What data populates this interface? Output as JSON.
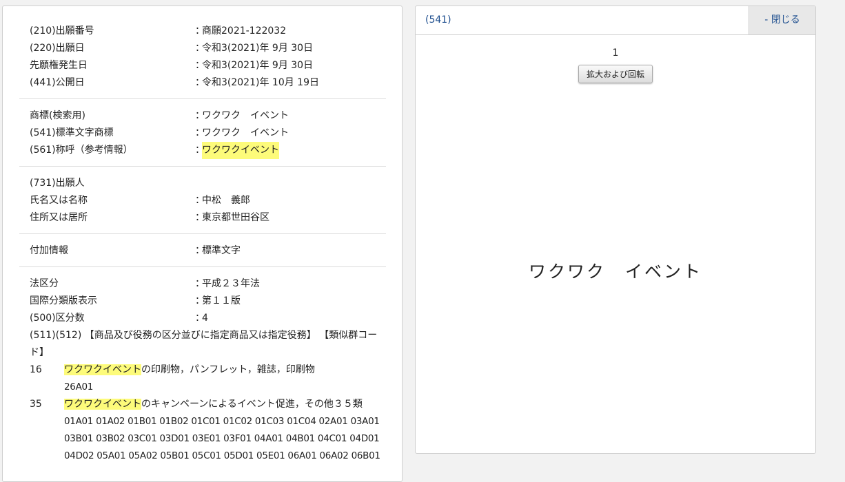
{
  "section1": [
    {
      "label": "(210)出願番号",
      "value": "商願2021-122032"
    },
    {
      "label": "(220)出願日",
      "value": "令和3(2021)年 9月 30日"
    },
    {
      "label": "先願権発生日",
      "value": "令和3(2021)年 9月 30日"
    },
    {
      "label": "(441)公開日",
      "value": "令和3(2021)年 10月 19日"
    }
  ],
  "section2": [
    {
      "label": "商標(検索用)",
      "value": "ワクワク　イベント"
    },
    {
      "label": "(541)標準文字商標",
      "value": "ワクワク　イベント"
    },
    {
      "label": "(561)称呼（参考情報）",
      "value": "ワクワクイベント"
    }
  ],
  "section3": {
    "heading": "(731)出願人",
    "rows": [
      {
        "label": "氏名又は名称",
        "value": "中松　義郎"
      },
      {
        "label": "住所又は居所",
        "value": "東京都世田谷区"
      }
    ]
  },
  "section4": [
    {
      "label": "付加情報",
      "value": "標準文字"
    }
  ],
  "section5": {
    "rows": [
      {
        "label": "法区分",
        "value": "平成２３年法"
      },
      {
        "label": "国際分類版表示",
        "value": "第１１版"
      },
      {
        "label": "(500)区分数",
        "value": "4"
      }
    ],
    "goods_heading": "(511)(512) 【商品及び役務の区分並びに指定商品又は指定役務】 【類似群コード】",
    "classes": [
      {
        "num": "16",
        "highlight": "ワクワクイベント",
        "text": "の印刷物，パンフレット，雑誌，印刷物",
        "codes": "26A01"
      },
      {
        "num": "35",
        "highlight": "ワクワクイベント",
        "text": "のキャンペーンによるイベント促進，その他３５類",
        "codes": "01A01 01A02 01B01 01B02 01C01 01C02 01C03 01C04 02A01 03A01 03B01 03B02 03C01 03D01 03E01 03F01 04A01 04B01 04C01 04D01 04D02 05A01 05A02 05B01 05C01 05D01 05E01 06A01 06A02 06B01"
      }
    ]
  },
  "separator": "：",
  "right_panel": {
    "title": "(541)",
    "close_label": "- 閉じる",
    "image_number": "1",
    "zoom_label": "拡大および回転",
    "mark_text": "ワクワク　イベント"
  },
  "colors": {
    "highlight": "#fdfb7a",
    "link": "#1f4f8f"
  }
}
